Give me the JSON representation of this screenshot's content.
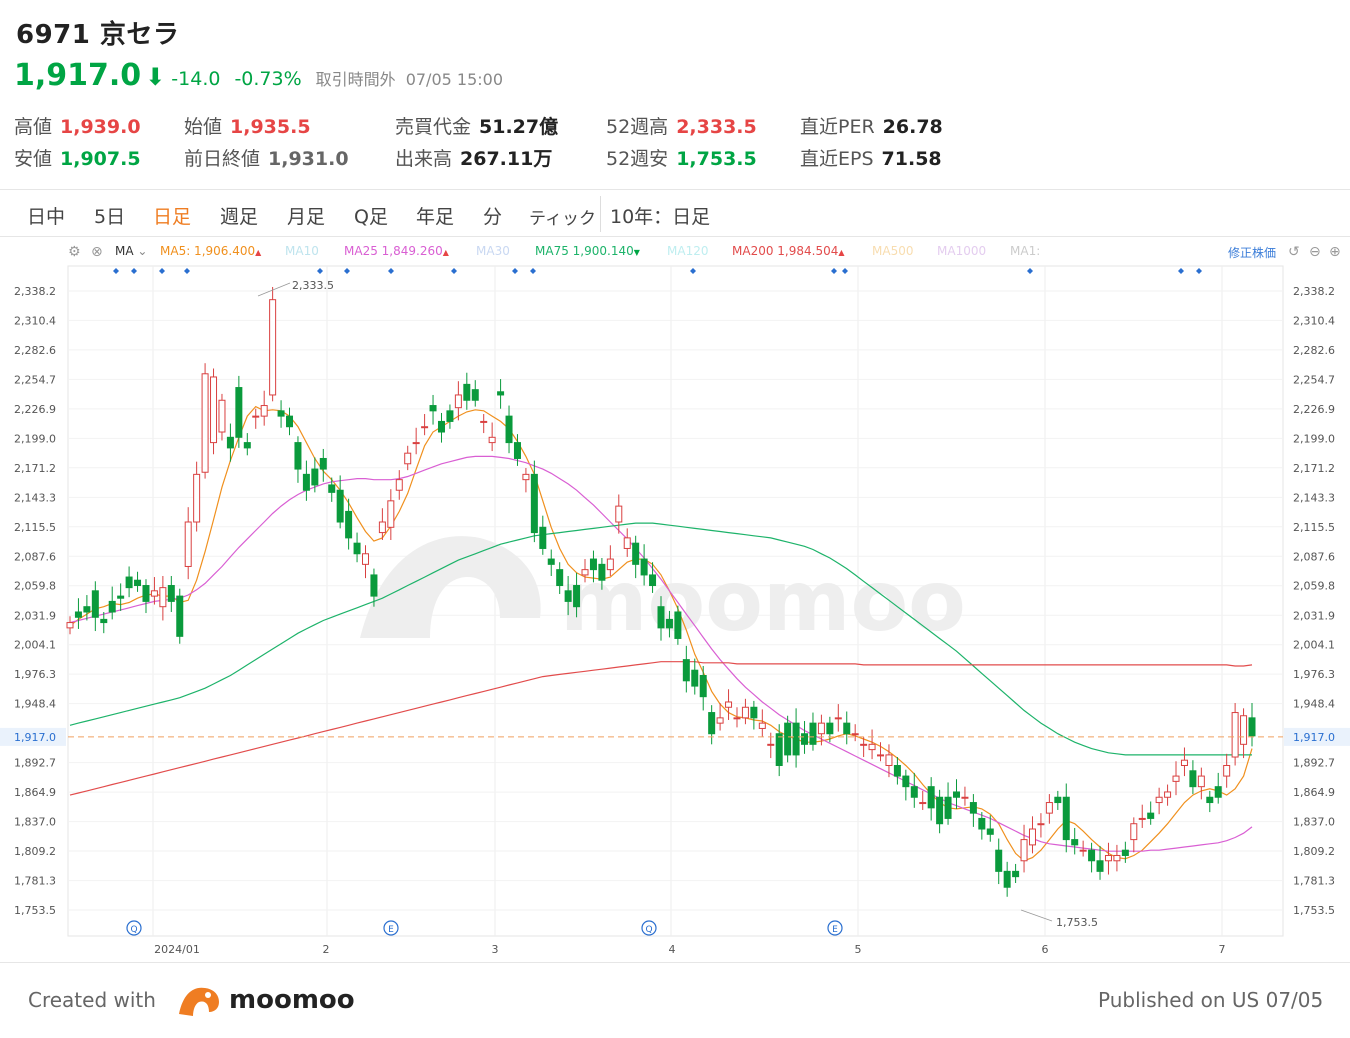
{
  "header": {
    "ticker_title": "6971 京セラ",
    "price": "1,917.0",
    "change": "-14.0",
    "change_pct": "-0.73%",
    "status": "取引時間外",
    "time": "07/05 15:00"
  },
  "stats": [
    {
      "label": "高値",
      "value": "1,939.0",
      "tone": "up"
    },
    {
      "label": "安値",
      "value": "1,907.5",
      "tone": "dn"
    },
    {
      "label": "始値",
      "value": "1,935.5",
      "tone": "up"
    },
    {
      "label": "前日終値",
      "value": "1,931.0",
      "tone": "nv_gray"
    },
    {
      "label": "売買代金",
      "value": "51.27億",
      "tone": "nv"
    },
    {
      "label": "出来高",
      "value": "267.11万",
      "tone": "nv"
    },
    {
      "label": "52週高",
      "value": "2,333.5",
      "tone": "up"
    },
    {
      "label": "52週安",
      "value": "1,753.5",
      "tone": "dn"
    },
    {
      "label": "直近PER",
      "value": "26.78",
      "tone": "nv"
    },
    {
      "label": "直近EPS",
      "value": "71.58",
      "tone": "nv"
    }
  ],
  "tabs": [
    "日中",
    "5日",
    "日足",
    "週足",
    "月足",
    "Q足",
    "年足",
    "分",
    "ティック"
  ],
  "active_tab": "日足",
  "range_label": "10年：日足",
  "ma_legend": {
    "selector": "MA",
    "items": [
      {
        "name": "MA5:",
        "value": "1,906.400",
        "dir": "▲",
        "color": "#f0901e",
        "dim": false
      },
      {
        "name": "MA10",
        "value": "",
        "dir": "",
        "color": "#bfe4ee",
        "dim": true
      },
      {
        "name": "MA25",
        "value": "1,849.260",
        "dir": "▲",
        "color": "#d95fd3",
        "dim": false
      },
      {
        "name": "MA30",
        "value": "",
        "dir": "",
        "color": "#c9d8f2",
        "dim": true
      },
      {
        "name": "MA75",
        "value": "1,900.140",
        "dir": "▼",
        "color": "#1db36a",
        "dim": false
      },
      {
        "name": "MA120",
        "value": "",
        "dir": "",
        "color": "#bfeef0",
        "dim": true
      },
      {
        "name": "MA200",
        "value": "1,984.504",
        "dir": "▲",
        "color": "#e24c4c",
        "dim": false
      },
      {
        "name": "MA500",
        "value": "",
        "dir": "",
        "color": "#f8ddb0",
        "dim": true
      },
      {
        "name": "MA1000",
        "value": "",
        "dir": "",
        "color": "#e4cdef",
        "dim": true
      },
      {
        "name": "MA1:",
        "value": "",
        "dir": "",
        "color": "#cccccc",
        "dim": true
      }
    ],
    "adjusted_label": "修正株価"
  },
  "colors": {
    "up": "#e64545",
    "down": "#00a544",
    "accent": "#ef7d22"
  },
  "chart_data": {
    "type": "candlestick",
    "y_ticks": [
      "2,338.2",
      "2,310.4",
      "2,282.6",
      "2,254.7",
      "2,226.9",
      "2,199.0",
      "2,171.2",
      "2,143.3",
      "2,115.5",
      "2,087.6",
      "2,059.8",
      "2,031.9",
      "2,004.1",
      "1,976.3",
      "1,948.4",
      "1,917.0",
      "1,892.7",
      "1,864.9",
      "1,837.0",
      "1,809.2",
      "1,781.3",
      "1,753.5"
    ],
    "ylim": [
      1740,
      2350
    ],
    "x_labels": [
      "2024/01",
      "2",
      "3",
      "4",
      "5",
      "6",
      "7"
    ],
    "current_price": 1917.0,
    "current_price_label": "1,917.0",
    "high_annotation": "2,333.5",
    "low_annotation": "1,753.5",
    "event_markers": [
      "Q",
      "E",
      "Q",
      "E"
    ],
    "candles": [
      [
        2020,
        2025
      ],
      [
        2035,
        2030
      ],
      [
        2040,
        2035
      ],
      [
        2055,
        2030
      ],
      [
        2028,
        2025
      ],
      [
        2045,
        2035
      ],
      [
        2050,
        2048
      ],
      [
        2068,
        2058
      ],
      [
        2065,
        2060
      ],
      [
        2060,
        2045
      ],
      [
        2050,
        2055
      ],
      [
        2040,
        2058
      ],
      [
        2060,
        2045
      ],
      [
        2050,
        2012
      ],
      [
        2078,
        2120
      ],
      [
        2120,
        2165
      ],
      [
        2167,
        2260
      ],
      [
        2195,
        2257
      ],
      [
        2205,
        2235
      ],
      [
        2200,
        2190
      ],
      [
        2247,
        2200
      ],
      [
        2195,
        2190
      ],
      [
        2220,
        2220
      ],
      [
        2220,
        2230
      ],
      [
        2240,
        2330
      ],
      [
        2225,
        2220
      ],
      [
        2220,
        2210
      ],
      [
        2195,
        2170
      ],
      [
        2165,
        2150
      ],
      [
        2170,
        2155
      ],
      [
        2180,
        2170
      ],
      [
        2155,
        2148
      ],
      [
        2150,
        2120
      ],
      [
        2130,
        2105
      ],
      [
        2100,
        2090
      ],
      [
        2080,
        2090
      ],
      [
        2070,
        2050
      ],
      [
        2110,
        2120
      ],
      [
        2115,
        2140
      ],
      [
        2150,
        2160
      ],
      [
        2175,
        2185
      ],
      [
        2195,
        2195
      ],
      [
        2210,
        2210
      ],
      [
        2230,
        2225
      ],
      [
        2215,
        2205
      ],
      [
        2225,
        2215
      ],
      [
        2228,
        2240
      ],
      [
        2250,
        2235
      ],
      [
        2245,
        2235
      ],
      [
        2215,
        2215
      ],
      [
        2195,
        2200
      ],
      [
        2243,
        2240
      ],
      [
        2220,
        2195
      ],
      [
        2195,
        2180
      ],
      [
        2160,
        2165
      ],
      [
        2165,
        2110
      ],
      [
        2115,
        2095
      ],
      [
        2085,
        2080
      ],
      [
        2075,
        2060
      ],
      [
        2055,
        2045
      ],
      [
        2060,
        2040
      ],
      [
        2070,
        2075
      ],
      [
        2085,
        2075
      ],
      [
        2080,
        2065
      ],
      [
        2075,
        2085
      ],
      [
        2120,
        2135
      ],
      [
        2095,
        2105
      ],
      [
        2100,
        2080
      ],
      [
        2085,
        2070
      ],
      [
        2070,
        2060
      ],
      [
        2040,
        2020
      ],
      [
        2028,
        2020
      ],
      [
        2035,
        2010
      ],
      [
        1990,
        1970
      ],
      [
        1980,
        1965
      ],
      [
        1975,
        1955
      ],
      [
        1940,
        1920
      ],
      [
        1930,
        1935
      ],
      [
        1945,
        1950
      ],
      [
        1935,
        1935
      ],
      [
        1935,
        1945
      ],
      [
        1945,
        1935
      ],
      [
        1925,
        1930
      ],
      [
        1910,
        1910
      ],
      [
        1920,
        1890
      ],
      [
        1930,
        1900
      ],
      [
        1930,
        1900
      ],
      [
        1920,
        1910
      ],
      [
        1930,
        1910
      ],
      [
        1920,
        1930
      ],
      [
        1930,
        1920
      ],
      [
        1935,
        1935
      ],
      [
        1930,
        1920
      ],
      [
        1920,
        1920
      ],
      [
        1910,
        1910
      ],
      [
        1905,
        1910
      ],
      [
        1900,
        1900
      ],
      [
        1890,
        1900
      ],
      [
        1890,
        1880
      ],
      [
        1880,
        1870
      ],
      [
        1870,
        1860
      ],
      [
        1855,
        1855
      ],
      [
        1870,
        1850
      ],
      [
        1860,
        1835
      ],
      [
        1860,
        1840
      ],
      [
        1865,
        1860
      ],
      [
        1860,
        1860
      ],
      [
        1855,
        1845
      ],
      [
        1840,
        1830
      ],
      [
        1830,
        1825
      ],
      [
        1810,
        1790
      ],
      [
        1790,
        1775
      ],
      [
        1790,
        1785
      ],
      [
        1800,
        1820
      ],
      [
        1815,
        1830
      ],
      [
        1835,
        1835
      ],
      [
        1845,
        1855
      ],
      [
        1860,
        1855
      ],
      [
        1860,
        1820
      ],
      [
        1820,
        1815
      ],
      [
        1810,
        1810
      ],
      [
        1810,
        1800
      ],
      [
        1800,
        1790
      ],
      [
        1800,
        1805
      ],
      [
        1800,
        1805
      ],
      [
        1810,
        1805
      ],
      [
        1820,
        1835
      ],
      [
        1840,
        1840
      ],
      [
        1845,
        1840
      ],
      [
        1855,
        1860
      ],
      [
        1860,
        1865
      ],
      [
        1875,
        1880
      ],
      [
        1890,
        1895
      ],
      [
        1885,
        1870
      ],
      [
        1870,
        1880
      ],
      [
        1860,
        1855
      ],
      [
        1870,
        1860
      ],
      [
        1880,
        1890
      ],
      [
        1898,
        1940
      ],
      [
        1910,
        1937
      ],
      [
        1935,
        1918
      ]
    ],
    "series": [
      {
        "name": "MA5",
        "color": "#f0901e",
        "values": [
          2022,
          2028,
          2033,
          2038,
          2040,
          2043,
          2042,
          2044,
          2048,
          2051,
          2052,
          2050,
          2050,
          2044,
          2046,
          2065,
          2092,
          2122,
          2153,
          2178,
          2200,
          2220,
          2229,
          2225,
          2226,
          2225,
          2220,
          2210,
          2195,
          2180,
          2168,
          2160,
          2150,
          2138,
          2124,
          2111,
          2102,
          2105,
          2116,
          2130,
          2147,
          2170,
          2192,
          2205,
          2210,
          2215,
          2220,
          2224,
          2226,
          2225,
          2220,
          2215,
          2208,
          2196,
          2182,
          2165,
          2140,
          2115,
          2095,
          2080,
          2072,
          2068,
          2067,
          2066,
          2068,
          2075,
          2082,
          2085,
          2085,
          2080,
          2070,
          2055,
          2038,
          2018,
          1995,
          1978,
          1960,
          1948,
          1940,
          1936,
          1935,
          1933,
          1932,
          1928,
          1922,
          1918,
          1915,
          1912,
          1912,
          1913,
          1915,
          1918,
          1920,
          1918,
          1915,
          1912,
          1908,
          1903,
          1897,
          1890,
          1882,
          1872,
          1863,
          1855,
          1850,
          1849,
          1850,
          1851,
          1849,
          1844,
          1835,
          1820,
          1807,
          1800,
          1803,
          1810,
          1820,
          1830,
          1838,
          1835,
          1828,
          1820,
          1813,
          1807,
          1803,
          1802,
          1805,
          1810,
          1818,
          1826,
          1835,
          1845,
          1855,
          1862,
          1866,
          1868,
          1866,
          1862,
          1868,
          1880,
          1906
        ]
      },
      {
        "name": "MA25",
        "color": "#d95fd3",
        "values": [
          2025,
          2027,
          2029,
          2031,
          2033,
          2035,
          2037,
          2039,
          2041,
          2043,
          2045,
          2046,
          2047,
          2048,
          2051,
          2056,
          2062,
          2070,
          2078,
          2087,
          2096,
          2104,
          2112,
          2120,
          2128,
          2135,
          2141,
          2146,
          2150,
          2153,
          2156,
          2158,
          2159,
          2160,
          2161,
          2161,
          2160,
          2160,
          2160,
          2161,
          2163,
          2166,
          2169,
          2172,
          2175,
          2177,
          2179,
          2181,
          2182,
          2182,
          2182,
          2181,
          2180,
          2178,
          2176,
          2173,
          2170,
          2166,
          2161,
          2156,
          2150,
          2143,
          2136,
          2128,
          2120,
          2112,
          2104,
          2095,
          2086,
          2076,
          2066,
          2055,
          2044,
          2033,
          2022,
          2011,
          2000,
          1990,
          1981,
          1972,
          1964,
          1957,
          1950,
          1944,
          1938,
          1933,
          1928,
          1923,
          1919,
          1915,
          1911,
          1907,
          1903,
          1899,
          1895,
          1891,
          1887,
          1883,
          1879,
          1875,
          1871,
          1867,
          1863,
          1859,
          1855,
          1852,
          1849,
          1846,
          1843,
          1840,
          1836,
          1832,
          1828,
          1824,
          1821,
          1818,
          1816,
          1815,
          1814,
          1813,
          1812,
          1811,
          1810,
          1809,
          1809,
          1809,
          1809,
          1809,
          1810,
          1810,
          1811,
          1812,
          1813,
          1814,
          1815,
          1816,
          1817,
          1819,
          1822,
          1826,
          1832
        ]
      },
      {
        "name": "MA75",
        "color": "#1db36a",
        "values": [
          1928,
          1930,
          1932,
          1934,
          1936,
          1938,
          1940,
          1942,
          1944,
          1946,
          1948,
          1950,
          1952,
          1954,
          1957,
          1960,
          1963,
          1967,
          1971,
          1975,
          1980,
          1985,
          1990,
          1995,
          2000,
          2005,
          2010,
          2015,
          2019,
          2023,
          2027,
          2030,
          2033,
          2036,
          2039,
          2042,
          2045,
          2048,
          2052,
          2056,
          2060,
          2064,
          2068,
          2072,
          2076,
          2080,
          2084,
          2087,
          2090,
          2093,
          2096,
          2099,
          2101,
          2103,
          2105,
          2107,
          2108,
          2109,
          2110,
          2111,
          2112,
          2113,
          2114,
          2115,
          2116,
          2117,
          2118,
          2119,
          2119,
          2119,
          2118,
          2117,
          2116,
          2115,
          2114,
          2113,
          2112,
          2111,
          2110,
          2109,
          2108,
          2107,
          2106,
          2105,
          2103,
          2101,
          2099,
          2097,
          2094,
          2090,
          2086,
          2081,
          2076,
          2070,
          2064,
          2058,
          2052,
          2046,
          2040,
          2034,
          2028,
          2022,
          2016,
          2010,
          2004,
          1998,
          1991,
          1984,
          1977,
          1970,
          1963,
          1956,
          1949,
          1942,
          1936,
          1930,
          1925,
          1920,
          1916,
          1912,
          1909,
          1906,
          1904,
          1902,
          1901,
          1900,
          1900,
          1900,
          1900,
          1900,
          1900,
          1900,
          1900,
          1900,
          1900,
          1900,
          1900,
          1900,
          1900,
          1900,
          1900
        ]
      },
      {
        "name": "MA200",
        "color": "#e24c4c",
        "values": [
          1862,
          1864,
          1866,
          1868,
          1870,
          1872,
          1874,
          1876,
          1878,
          1880,
          1882,
          1884,
          1886,
          1888,
          1890,
          1892,
          1894,
          1896,
          1898,
          1900,
          1902,
          1904,
          1906,
          1908,
          1910,
          1912,
          1914,
          1916,
          1918,
          1920,
          1922,
          1924,
          1926,
          1928,
          1930,
          1932,
          1934,
          1936,
          1938,
          1940,
          1942,
          1944,
          1946,
          1948,
          1950,
          1952,
          1954,
          1956,
          1958,
          1960,
          1962,
          1964,
          1966,
          1968,
          1970,
          1972,
          1974,
          1975,
          1976,
          1977,
          1978,
          1979,
          1980,
          1981,
          1982,
          1983,
          1984,
          1985,
          1986,
          1987,
          1988,
          1988,
          1988,
          1988,
          1988,
          1987,
          1987,
          1987,
          1987,
          1986,
          1986,
          1986,
          1986,
          1986,
          1986,
          1986,
          1986,
          1986,
          1986,
          1986,
          1986,
          1986,
          1986,
          1986,
          1985,
          1985,
          1985,
          1985,
          1985,
          1985,
          1985,
          1985,
          1985,
          1985,
          1985,
          1985,
          1985,
          1985,
          1985,
          1985,
          1985,
          1985,
          1985,
          1985,
          1985,
          1985,
          1985,
          1985,
          1985,
          1985,
          1985,
          1985,
          1985,
          1985,
          1985,
          1985,
          1985,
          1985,
          1985,
          1985,
          1985,
          1985,
          1985,
          1985,
          1985,
          1985,
          1985,
          1985,
          1984,
          1984,
          1985
        ]
      }
    ]
  },
  "watermark": "moomoo",
  "footer": {
    "created_with": "Created with",
    "brand": "moomoo",
    "published": "Published on US 07/05"
  }
}
